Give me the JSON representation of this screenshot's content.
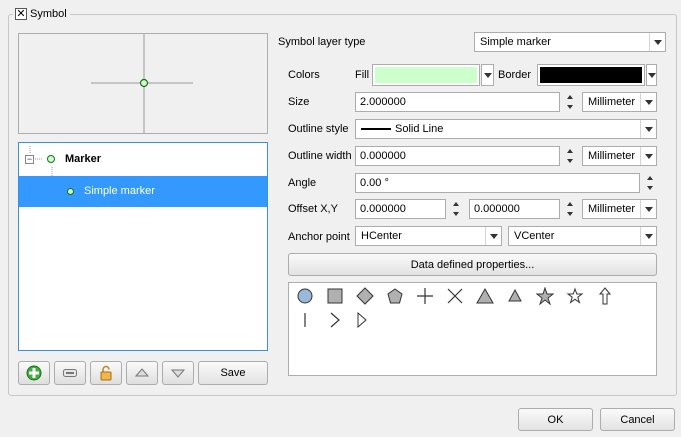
{
  "group": {
    "title": "Symbol",
    "checked": true
  },
  "tree": {
    "root_label": "Marker",
    "child_label": "Simple marker"
  },
  "toolbar": {
    "save_label": "Save"
  },
  "props": {
    "layer_type_label": "Symbol layer type",
    "layer_type_value": "Simple marker",
    "colors_label": "Colors",
    "fill_label": "Fill",
    "fill_color": "#ccffcc",
    "border_label": "Border",
    "border_color": "#000000",
    "size_label": "Size",
    "size_value": "2.000000",
    "size_unit": "Millimeter",
    "outline_style_label": "Outline style",
    "outline_style_value": "Solid Line",
    "outline_width_label": "Outline width",
    "outline_width_value": "0.000000",
    "outline_width_unit": "Millimeter",
    "angle_label": "Angle",
    "angle_value": "0.00 °",
    "offset_label": "Offset X,Y",
    "offset_x": "0.000000",
    "offset_y": "0.000000",
    "offset_unit": "Millimeter",
    "anchor_label": "Anchor point",
    "anchor_h": "HCenter",
    "anchor_v": "VCenter",
    "ddp_label": "Data defined properties..."
  },
  "marker_shapes": [
    "circle",
    "square",
    "diamond",
    "pentagon",
    "cross",
    "x",
    "triangle",
    "equilateral-triangle",
    "star",
    "regular-star",
    "arrow",
    "line",
    "arrowhead",
    "filled-arrowhead"
  ],
  "footer": {
    "ok_label": "OK",
    "cancel_label": "Cancel"
  }
}
